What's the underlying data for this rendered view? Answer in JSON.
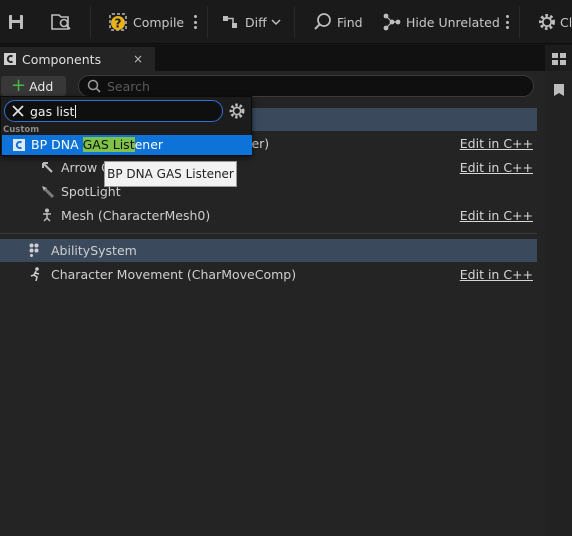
{
  "colors": {
    "accent_blue": "#0e73d9",
    "highlight_green": "#7fc24a",
    "add_plus_green": "#49b449",
    "selected_row": "#3a4a5c"
  },
  "toolbar": {
    "compile_label": "Compile",
    "diff_label": "Diff",
    "find_label": "Find",
    "hide_unrelated_label": "Hide Unrelated",
    "class_settings_label": "Cl"
  },
  "tab": {
    "label": "Components",
    "close_glyph": "×"
  },
  "components_panel": {
    "add_label": "Add",
    "search_placeholder": "Search",
    "rows": [
      {
        "label": ")",
        "edit": ""
      },
      {
        "label": "ler)",
        "edit": "Edit in C++"
      },
      {
        "label": "Arrow C",
        "edit": "Edit in C++"
      },
      {
        "label": "SpotLight",
        "edit": ""
      },
      {
        "label": "Mesh (CharacterMesh0)",
        "edit": "Edit in C++"
      },
      {
        "label": "AbilitySystem",
        "edit": ""
      },
      {
        "label": "Character Movement (CharMoveComp)",
        "edit": "Edit in C++"
      }
    ]
  },
  "add_component_popup": {
    "search_value": "gas list",
    "category": "Custom",
    "result_prefix": "BP DNA ",
    "result_match": "GAS List",
    "result_suffix": "ener",
    "tooltip": "BP DNA GAS Listener"
  }
}
